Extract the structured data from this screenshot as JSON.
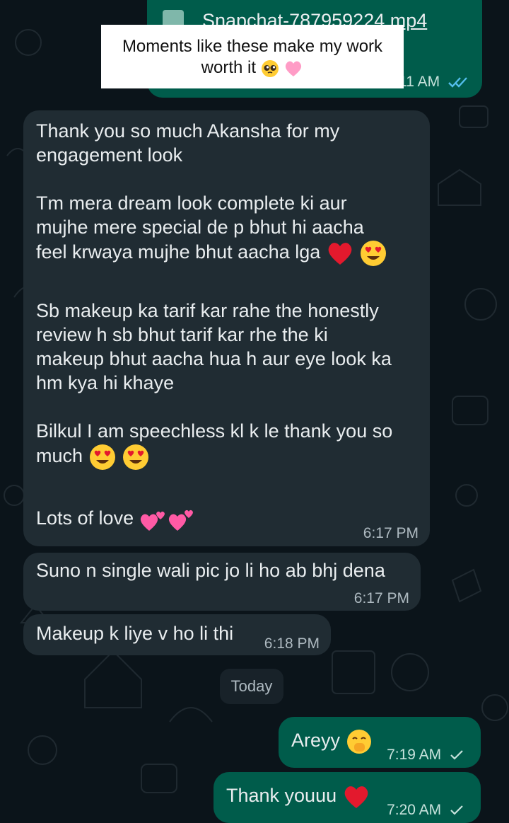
{
  "top_message": {
    "file_name": "Snapchat-787959224.mp4",
    "time": "6:11 AM",
    "overlay_caption_line1": "Moments like these make my work",
    "overlay_caption_line2": "worth it"
  },
  "long_message": {
    "p1_line1": "Thank you so much Akansha for my",
    "p1_line2": "engagement look",
    "p2_line1": "Tm mera dream look complete ki aur",
    "p2_line2": "mujhe mere special de p bhut hi aacha",
    "p2_line3": "feel krwaya mujhe bhut aacha lga",
    "p3_line1": "Sb makeup ka tarif kar rahe the honestly",
    "p3_line2": "review h sb bhut tarif kar rhe the ki",
    "p3_line3": "makeup bhut aacha hua h aur eye look ka",
    "p3_line4": "hm kya hi khaye",
    "p4_line1": "Bilkul I am speechless kl k le thank you so",
    "p4_line2": "much",
    "p5_line1": "Lots of love",
    "time": "6:17 PM"
  },
  "message_2": {
    "text": "Suno n single wali pic jo li ho ab bhj dena",
    "time": "6:17 PM"
  },
  "message_3": {
    "text": "Makeup k liye v ho li thi",
    "time": "6:18 PM"
  },
  "date_separator": "Today",
  "reply_1": {
    "text": "Areyy",
    "time": "7:19 AM"
  },
  "reply_2": {
    "text": "Thank youuu",
    "time": "7:20 AM"
  },
  "icons": {
    "double_tick": "double-check-icon",
    "single_tick": "check-icon",
    "heart": "red-heart-emoji",
    "heart_eyes": "heart-eyes-emoji",
    "two_hearts": "two-hearts-emoji",
    "pleading": "pleading-face-emoji",
    "pink_heart": "pink-heart-emoji",
    "hand_over_mouth": "hand-over-mouth-emoji"
  },
  "colors": {
    "background": "#0b141a",
    "incoming_bubble": "#202c33",
    "outgoing_bubble": "#005c4b",
    "read_ticks": "#53bdeb"
  }
}
